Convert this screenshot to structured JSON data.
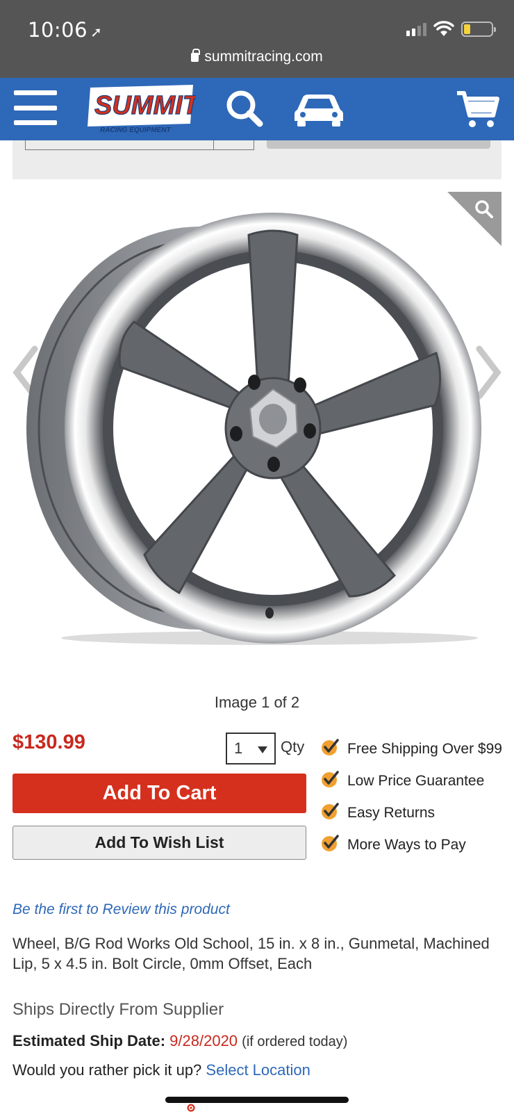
{
  "status_bar": {
    "time": "10:06",
    "url": "summitracing.com"
  },
  "nav": {
    "logo_text": "SUMMIT",
    "logo_subtext": "RACING EQUIPMENT"
  },
  "gallery": {
    "caption": "Image 1 of 2"
  },
  "purchase": {
    "price": "$130.99",
    "qty_value": "1",
    "qty_label": "Qty",
    "add_to_cart": "Add To Cart",
    "add_to_wish_list": "Add To Wish List"
  },
  "benefits": [
    "Free Shipping Over $99",
    "Low Price Guarantee",
    "Easy Returns",
    "More Ways to Pay"
  ],
  "product": {
    "review_link": "Be the first to Review this product",
    "description": "Wheel, B/G Rod Works Old School, 15 in. x 8 in., Gunmetal, Machined Lip, 5 x 4.5 in. Bolt Circle, 0mm Offset, Each"
  },
  "shipping": {
    "heading": "Ships Directly From Supplier",
    "date_label": "Estimated Ship Date:",
    "date_value": "9/28/2020",
    "date_note": "(if ordered today)",
    "pickup_question": "Would you rather pick it up?",
    "pickup_link": "Select Location"
  },
  "colors": {
    "nav_blue": "#2e68b8",
    "price_red": "#c8281e",
    "cart_red": "#d5301e",
    "check_orange": "#f0a030"
  }
}
